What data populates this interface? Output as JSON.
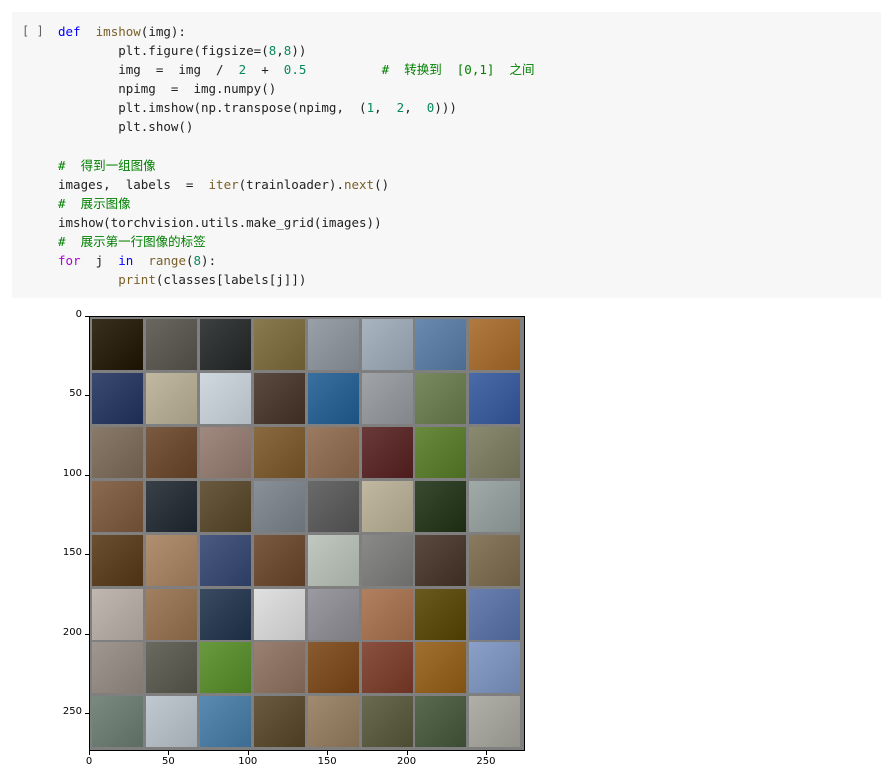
{
  "cell": {
    "run_indicator": "[ ]",
    "code_lines": [
      [
        {
          "t": "def",
          "c": "kw"
        },
        {
          "t": "  "
        },
        {
          "t": "imshow",
          "c": "fn"
        },
        {
          "t": "(img):"
        }
      ],
      [
        {
          "t": "        plt.figure(figsize=("
        },
        {
          "t": "8",
          "c": "num"
        },
        {
          "t": ","
        },
        {
          "t": "8",
          "c": "num"
        },
        {
          "t": "))"
        }
      ],
      [
        {
          "t": "        img  =  img  /  "
        },
        {
          "t": "2",
          "c": "num"
        },
        {
          "t": "  +  "
        },
        {
          "t": "0.5",
          "c": "num"
        },
        {
          "t": "          "
        },
        {
          "t": "#  转换到  [0,1]  之间",
          "c": "cm"
        }
      ],
      [
        {
          "t": "        npimg  =  img.numpy()"
        }
      ],
      [
        {
          "t": "        plt.imshow(np.transpose(npimg,  ("
        },
        {
          "t": "1",
          "c": "num"
        },
        {
          "t": ",  "
        },
        {
          "t": "2",
          "c": "num"
        },
        {
          "t": ",  "
        },
        {
          "t": "0",
          "c": "num"
        },
        {
          "t": ")))"
        }
      ],
      [
        {
          "t": "        plt.show()"
        }
      ],
      [
        {
          "t": ""
        }
      ],
      [
        {
          "t": "#  得到一组图像",
          "c": "cm"
        }
      ],
      [
        {
          "t": "images,  labels  =  "
        },
        {
          "t": "iter",
          "c": "fn"
        },
        {
          "t": "(trainloader)."
        },
        {
          "t": "next",
          "c": "fn"
        },
        {
          "t": "()"
        }
      ],
      [
        {
          "t": "#  展示图像",
          "c": "cm"
        }
      ],
      [
        {
          "t": "imshow(torchvision.utils.make_grid(images))"
        }
      ],
      [
        {
          "t": "#  展示第一行图像的标签",
          "c": "cm"
        }
      ],
      [
        {
          "t": "for",
          "c": "kw2"
        },
        {
          "t": "  j  "
        },
        {
          "t": "in",
          "c": "kw"
        },
        {
          "t": "  "
        },
        {
          "t": "range",
          "c": "fn"
        },
        {
          "t": "("
        },
        {
          "t": "8",
          "c": "num"
        },
        {
          "t": "):"
        }
      ],
      [
        {
          "t": "        "
        },
        {
          "t": "print",
          "c": "fn"
        },
        {
          "t": "(classes[labels[j]])"
        }
      ]
    ]
  },
  "plot": {
    "y_ticks": [
      "0",
      "50",
      "100",
      "150",
      "200",
      "250"
    ],
    "x_ticks": [
      "0",
      "50",
      "100",
      "150",
      "200",
      "250"
    ],
    "tile_colors": [
      [
        "#3a3020",
        "#6a6660",
        "#3c4040",
        "#8a7a50",
        "#9aa0a8",
        "#a8b4c0",
        "#6a8ab0",
        "#b07a40"
      ],
      [
        "#3a4a70",
        "#c0b8a0",
        "#d0d8e0",
        "#5a4a40",
        "#3a70a0",
        "#a0a4a8",
        "#7a8a60",
        "#4a6aa8"
      ],
      [
        "#8a7a6a",
        "#7a5a40",
        "#a08a80",
        "#8a6a40",
        "#9a7a60",
        "#6a3a3a",
        "#6a8a40",
        "#8a8a70"
      ],
      [
        "#8a6a50",
        "#3a4048",
        "#6a5a40",
        "#8a9098",
        "#6a6a6a",
        "#c0b8a0",
        "#3a4a30",
        "#a0aaa8"
      ],
      [
        "#6a5030",
        "#b09070",
        "#4a5a80",
        "#7a5a40",
        "#c0c8c0",
        "#8a8a88",
        "#5a4a40",
        "#8a7a60"
      ],
      [
        "#c0b8b0",
        "#a08060",
        "#3a4a60",
        "#e0e0e0",
        "#9a9aa0",
        "#b08060",
        "#6a5a20",
        "#6a80b0"
      ],
      [
        "#a09890",
        "#6a6a60",
        "#6a9a40",
        "#9a8070",
        "#8a5a30",
        "#8a5040",
        "#a07030",
        "#8aa0c8"
      ],
      [
        "#7a8a80",
        "#c0c8d0",
        "#5a8ab0",
        "#6a5a40",
        "#a08a70",
        "#6a6a50",
        "#5a6a50",
        "#b0b0a8"
      ]
    ]
  }
}
